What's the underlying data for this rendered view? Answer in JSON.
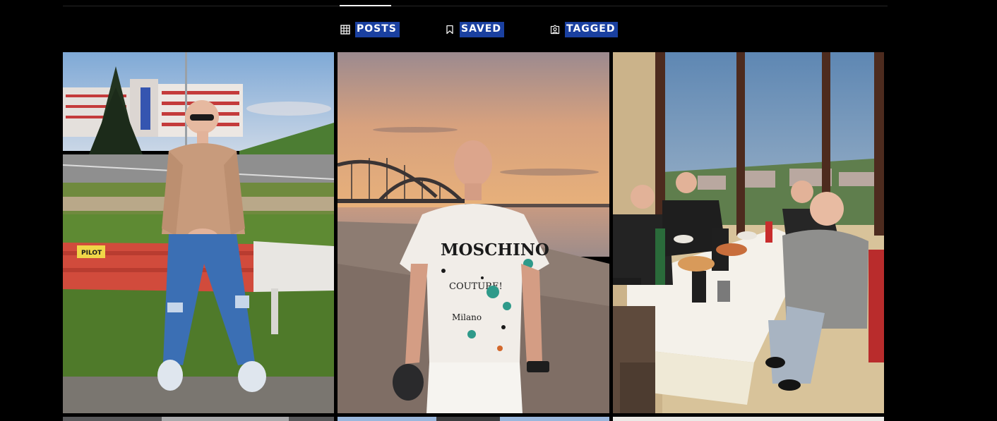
{
  "tabs": [
    {
      "label": "POSTS",
      "icon": "grid-icon",
      "active": true
    },
    {
      "label": "SAVED",
      "icon": "bookmark-icon",
      "active": false
    },
    {
      "label": "TAGGED",
      "icon": "tagged-user-icon",
      "active": false
    }
  ],
  "colors": {
    "background": "#000000",
    "text": "#ffffff",
    "label_highlight": "#1a40a0",
    "divider": "#262626"
  },
  "posts": [
    {
      "subject": "man in tan sweater and ripped jeans sitting on red guardrail by road"
    },
    {
      "subject": "man in white graffiti t-shirt on beach at sunset with arched bridge"
    },
    {
      "subject": "group of men at restaurant table by window overlooking town"
    },
    {
      "subject": "post thumbnail (partially visible)"
    },
    {
      "subject": "post thumbnail (partially visible)"
    },
    {
      "subject": "post thumbnail (partially visible)"
    }
  ],
  "post_texts": {
    "shirt_print": "MOSCHINO",
    "shirt_sub": "COUTURE!",
    "shirt_city": "Milano",
    "sign_text": "PILOT"
  }
}
